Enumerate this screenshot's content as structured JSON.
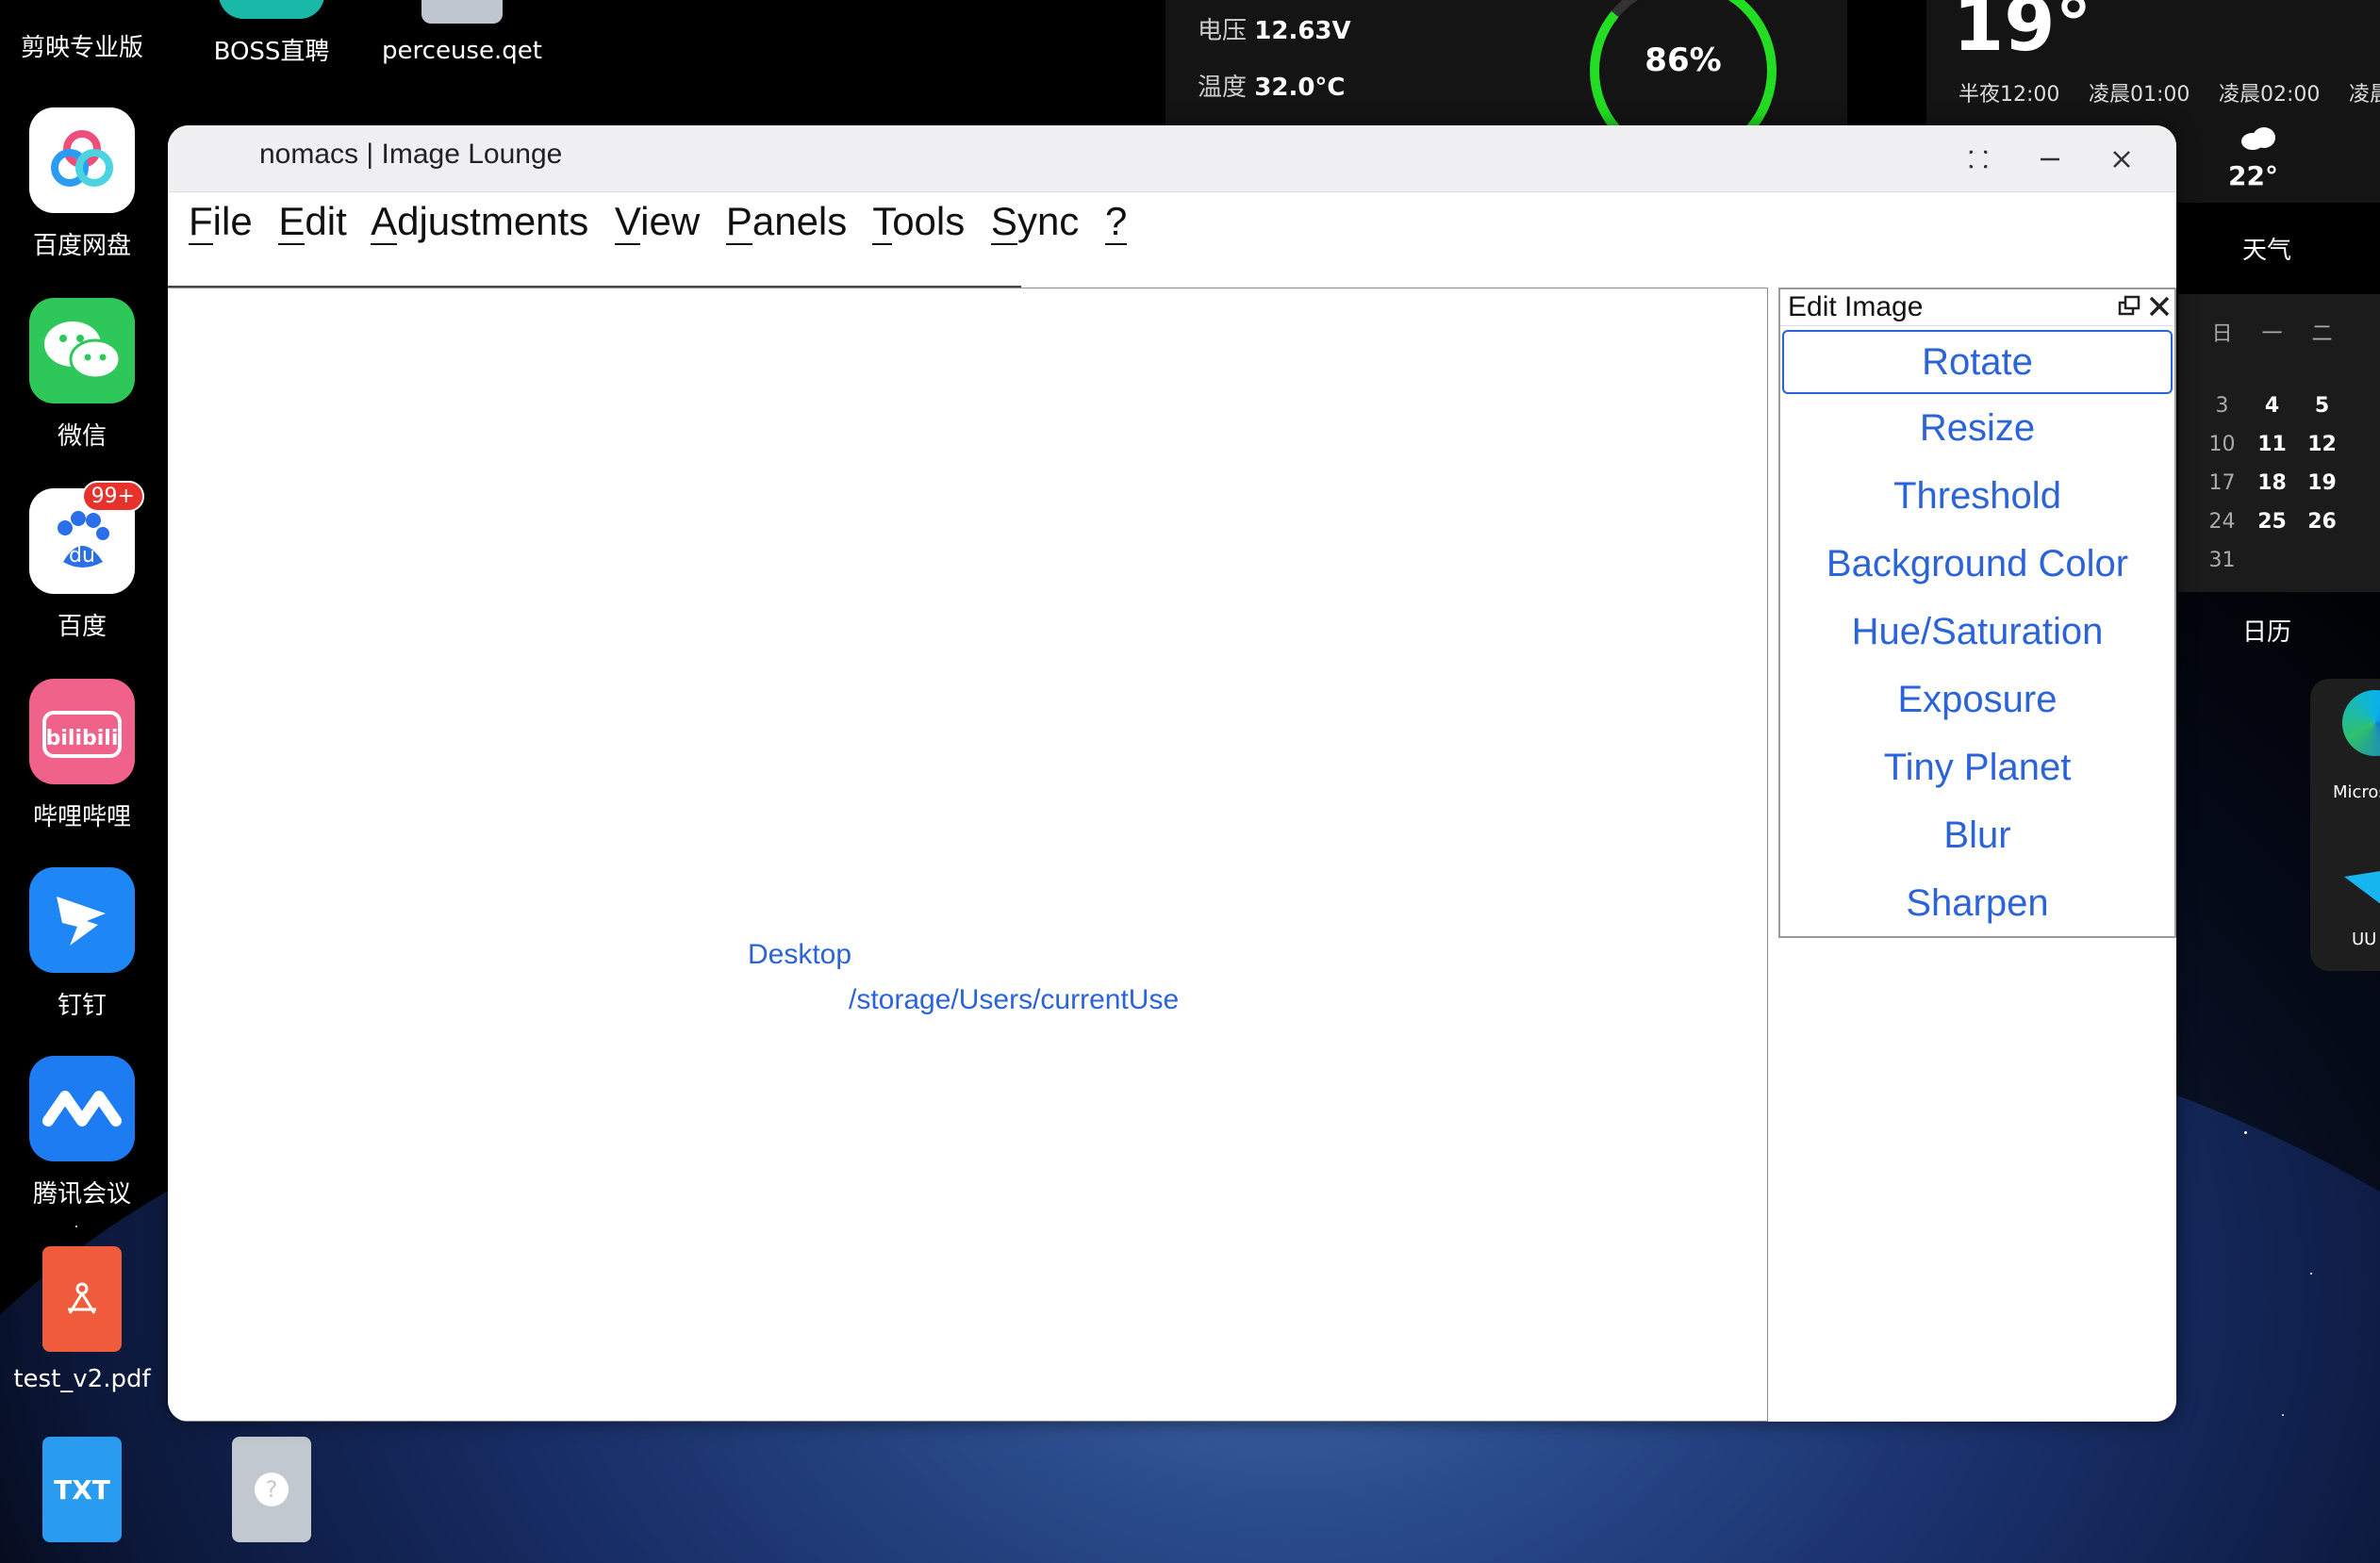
{
  "desktop": {
    "icons": [
      {
        "label": "剪映专业版"
      },
      {
        "label": "BOSS直聘"
      },
      {
        "label": "perceuse.qet"
      },
      {
        "label": "百度网盘"
      },
      {
        "label": "微信"
      },
      {
        "label": "百度",
        "badge": "99+"
      },
      {
        "label": "哔哩哔哩",
        "glyph": "bilibili"
      },
      {
        "label": "钉钉"
      },
      {
        "label": "腾讯会议"
      },
      {
        "label": "test_v2.pdf"
      },
      {
        "label": "TXT"
      }
    ],
    "partial_labels": [
      "Micros",
      "UU"
    ]
  },
  "widgets": {
    "battery": {
      "voltage_label": "电压",
      "voltage_value": "12.63V",
      "temp_label": "温度",
      "temp_value": "32.0°C",
      "percent": "86%",
      "level": 0.86,
      "ring_color": "#22dd22"
    },
    "weather": {
      "current_temp": "19°",
      "hours": [
        "半夜12:00",
        "凌晨01:00",
        "凌晨02:00",
        "凌晨"
      ],
      "forecast_temp": "22°",
      "caption": "天气"
    },
    "calendar": {
      "weekday_labels": [
        "日",
        "一",
        "二"
      ],
      "rows": [
        [
          "3",
          "4",
          "5"
        ],
        [
          "10",
          "11",
          "12"
        ],
        [
          "17",
          "18",
          "19"
        ],
        [
          "24",
          "25",
          "26"
        ],
        [
          "31",
          "",
          ""
        ]
      ],
      "caption": "日历"
    }
  },
  "window": {
    "title": "nomacs | Image Lounge",
    "menu": [
      {
        "mnemonic": "F",
        "rest": "ile"
      },
      {
        "mnemonic": "E",
        "rest": "dit"
      },
      {
        "mnemonic": "A",
        "rest": "djustments"
      },
      {
        "mnemonic": "V",
        "rest": "iew"
      },
      {
        "mnemonic": "P",
        "rest": "anels"
      },
      {
        "mnemonic": "T",
        "rest": "ools"
      },
      {
        "mnemonic": "S",
        "rest": "ync"
      },
      {
        "mnemonic": "?",
        "rest": ""
      }
    ],
    "recent": {
      "folder_label": "Desktop",
      "path": "/storage/Users/currentUse"
    },
    "edit_panel": {
      "title": "Edit Image",
      "items": [
        "Rotate",
        "Resize",
        "Threshold",
        "Background Color",
        "Hue/Saturation",
        "Exposure",
        "Tiny Planet",
        "Blur",
        "Sharpen"
      ],
      "selected": "Rotate",
      "accent": "#2b63d8"
    }
  }
}
